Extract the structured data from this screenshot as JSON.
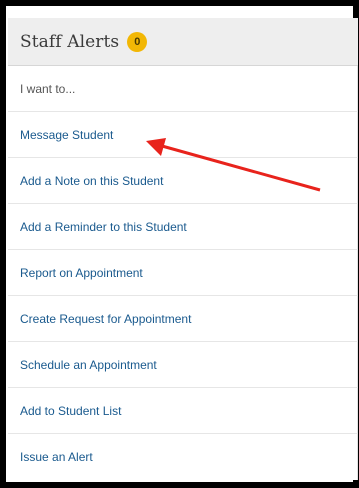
{
  "panel": {
    "title": "Staff Alerts",
    "badge_count": "0"
  },
  "menu": {
    "intro": "I want to...",
    "items": [
      {
        "label": "Message Student"
      },
      {
        "label": "Add a Note on this Student"
      },
      {
        "label": "Add a Reminder to this Student"
      },
      {
        "label": "Report on Appointment"
      },
      {
        "label": "Create Request for Appointment"
      },
      {
        "label": "Schedule an Appointment"
      },
      {
        "label": "Add to Student List"
      },
      {
        "label": "Issue an Alert"
      }
    ]
  },
  "annotation": {
    "arrow_color": "#e8231c"
  }
}
